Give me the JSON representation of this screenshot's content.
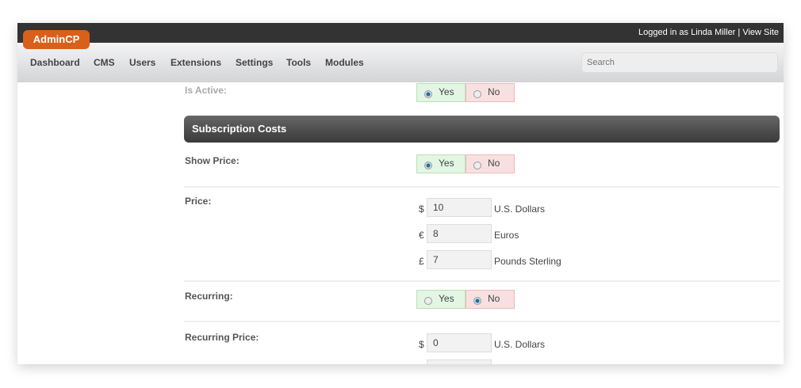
{
  "app": {
    "logo": "AdminCP",
    "logged_in": "Logged in as Linda Miller",
    "separator": "|",
    "view_site": "View Site"
  },
  "nav": [
    "Dashboard",
    "CMS",
    "Users",
    "Extensions",
    "Settings",
    "Tools",
    "Modules"
  ],
  "search": {
    "placeholder": "Search"
  },
  "form": {
    "is_active": {
      "label": "Is Active:",
      "yes": "Yes",
      "no": "No",
      "value": "Yes"
    },
    "section": "Subscription Costs",
    "show_price": {
      "label": "Show Price:",
      "yes": "Yes",
      "no": "No",
      "value": "Yes"
    },
    "price": {
      "label": "Price:",
      "rows": [
        {
          "symbol": "$",
          "value": "10",
          "currency": "U.S. Dollars"
        },
        {
          "symbol": "€",
          "value": "8",
          "currency": "Euros"
        },
        {
          "symbol": "£",
          "value": "7",
          "currency": "Pounds Sterling"
        }
      ]
    },
    "recurring": {
      "label": "Recurring:",
      "yes": "Yes",
      "no": "No",
      "value": "No"
    },
    "recurring_price": {
      "label": "Recurring Price:",
      "rows": [
        {
          "symbol": "$",
          "value": "0",
          "currency": "U.S. Dollars"
        }
      ]
    }
  }
}
